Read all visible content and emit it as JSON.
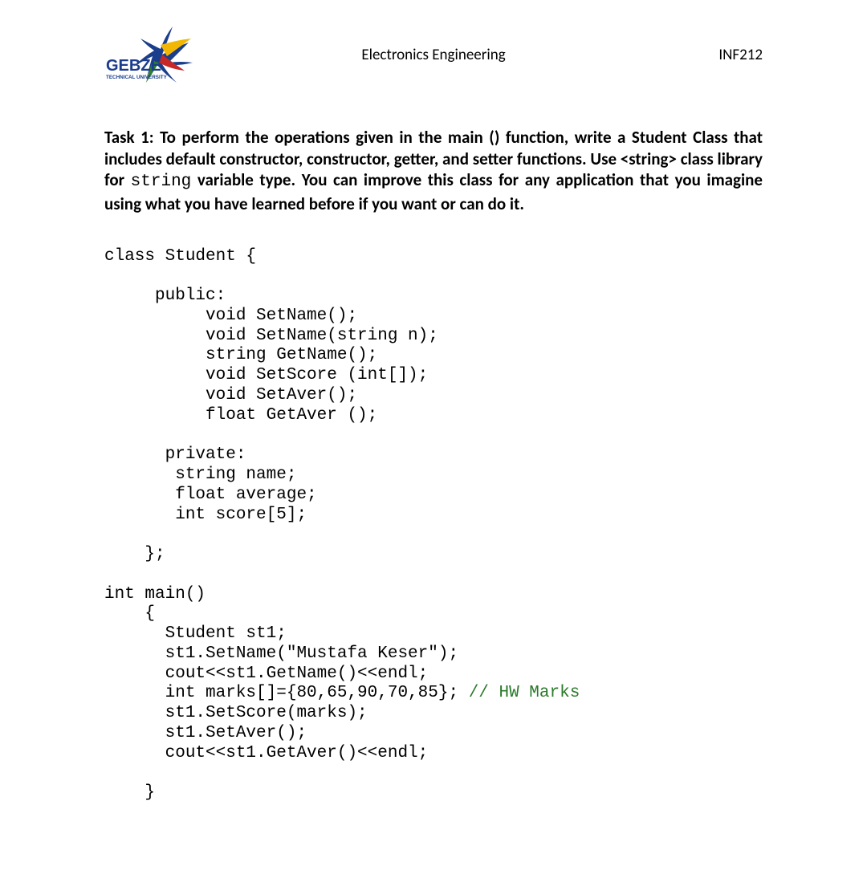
{
  "header": {
    "university_main": "GEBZE",
    "university_sub": "TECHNICAL UNIVERSITY",
    "department": "Electronics Engineering",
    "course_code": "INF212"
  },
  "task": {
    "lead": "Task 1: To perform the operations given in the main () function, write a Student Class that includes default constructor, constructor, getter, and setter functions. Use <string> class library for ",
    "mono": "string",
    "tail": " variable type. You can improve this class for any application that you imagine using what you have learned before if you want or can do it."
  },
  "code": {
    "lines": [
      "class Student {",
      "",
      "     public:",
      "          void SetName();",
      "          void SetName(string n);",
      "          string GetName();",
      "          void SetScore (int[]);",
      "          void SetAver();",
      "          float GetAver ();",
      "",
      "      private:",
      "       string name;",
      "       float average;",
      "       int score[5];",
      "",
      "    };",
      "",
      "int main()",
      "    {",
      "      Student st1;",
      "      st1.SetName(\"Mustafa Keser\");",
      "      cout<<st1.GetName()<<endl;"
    ],
    "marks_line_prefix": "      int marks[]={80,65,90,70,85}; ",
    "marks_comment": "// HW Marks",
    "lines_after": [
      "      st1.SetScore(marks);",
      "      st1.SetAver();",
      "      cout<<st1.GetAver()<<endl;",
      "",
      "    }"
    ]
  }
}
